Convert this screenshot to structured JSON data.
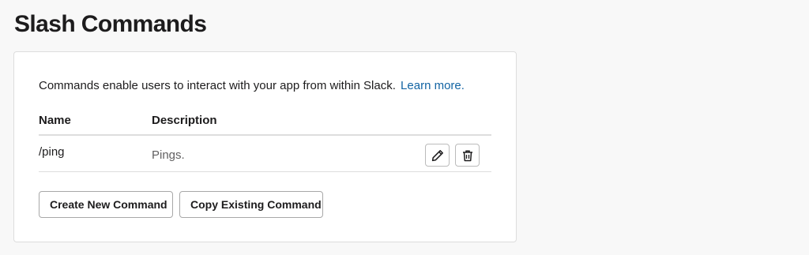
{
  "page": {
    "title": "Slash Commands"
  },
  "card": {
    "intro_text": "Commands enable users to interact with your app from within Slack.",
    "learn_more_label": "Learn more."
  },
  "table": {
    "columns": [
      "Name",
      "Description"
    ],
    "rows": [
      {
        "name": "/ping",
        "description": "Pings."
      }
    ]
  },
  "actions": {
    "edit_icon": "pencil-icon",
    "delete_icon": "trash-icon",
    "create_label": "Create New Command",
    "copy_label": "Copy Existing Command"
  },
  "colors": {
    "link": "#1264a3",
    "muted_text": "#616061",
    "border": "#dddddd"
  }
}
